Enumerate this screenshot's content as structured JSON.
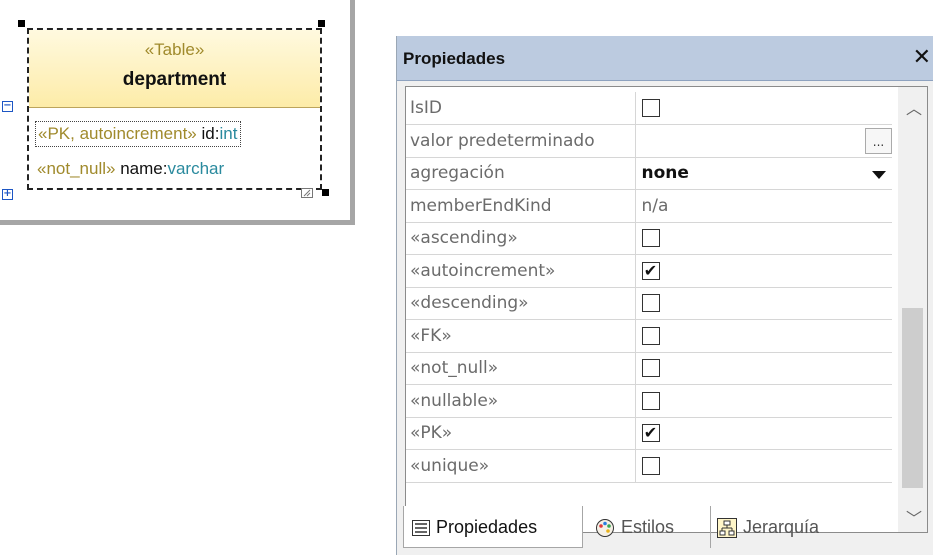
{
  "diagram": {
    "class": {
      "stereotype": "«Table»",
      "name": "department",
      "attributes": [
        {
          "stereotype": "«PK, autoincrement»",
          "name": "id",
          "type": "int"
        },
        {
          "stereotype": "«not_null»",
          "name": "name",
          "type": "varchar"
        }
      ],
      "colors": {
        "header_top": "#fff9df",
        "header_bottom": "#fdeca8",
        "stereotype": "#a08a2c",
        "type": "#2a8a9e"
      }
    }
  },
  "panel": {
    "title": "Propiedades",
    "close_icon": "close-icon",
    "properties": [
      {
        "name": "IsID",
        "kind": "checkbox",
        "checked": false
      },
      {
        "name": "valor predeterminado",
        "kind": "text-button",
        "value": "",
        "button": "..."
      },
      {
        "name": "agregación",
        "kind": "combo",
        "value": "none"
      },
      {
        "name": "memberEndKind",
        "kind": "text",
        "value": "n/a"
      },
      {
        "name": "«ascending»",
        "kind": "checkbox",
        "checked": false
      },
      {
        "name": "«autoincrement»",
        "kind": "checkbox",
        "checked": true
      },
      {
        "name": "«descending»",
        "kind": "checkbox",
        "checked": false
      },
      {
        "name": "«FK»",
        "kind": "checkbox",
        "checked": false
      },
      {
        "name": "«not_null»",
        "kind": "checkbox",
        "checked": false
      },
      {
        "name": "«nullable»",
        "kind": "checkbox",
        "checked": false
      },
      {
        "name": "«PK»",
        "kind": "checkbox",
        "checked": true
      },
      {
        "name": "«unique»",
        "kind": "checkbox",
        "checked": false
      }
    ],
    "tabs": [
      {
        "label": "Propiedades",
        "icon": "list-icon",
        "active": true
      },
      {
        "label": "Estilos",
        "icon": "palette-icon",
        "active": false
      },
      {
        "label": "Jerarquía",
        "icon": "hierarchy-icon",
        "active": false
      }
    ],
    "colors": {
      "title_bar": "#bccbe0",
      "check_mark": "#111111"
    }
  }
}
